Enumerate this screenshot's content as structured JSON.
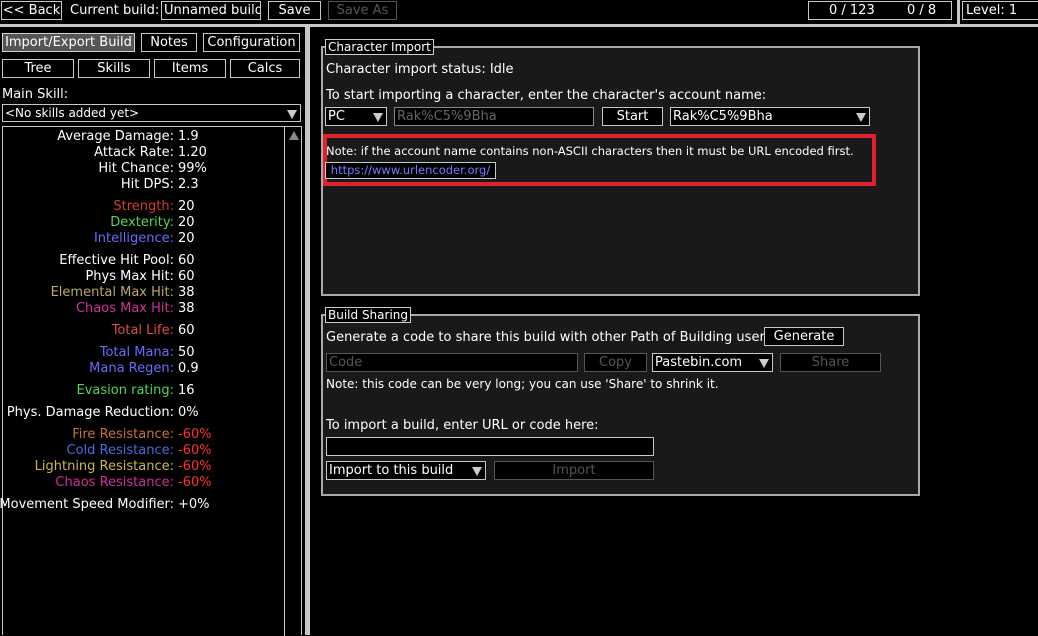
{
  "topbar": {
    "back_label": "<< Back",
    "current_build_label": "Current build:",
    "build_name": "Unnamed build",
    "save_label": "Save",
    "save_as_label": "Save As",
    "points": "0 / 123",
    "ascend": "0 / 8",
    "level_label": "Level: 1"
  },
  "tabs": {
    "import_export": "Import/Export Build",
    "notes": "Notes",
    "configuration": "Configuration",
    "tree": "Tree",
    "skills": "Skills",
    "items": "Items",
    "calcs": "Calcs"
  },
  "main_skill": {
    "label": "Main Skill:",
    "value": "<No skills added yet>"
  },
  "stats": [
    {
      "label": "Average Damage:",
      "value": "1.9",
      "color": "#ffffff"
    },
    {
      "label": "Attack Rate:",
      "value": "1.20",
      "color": "#ffffff"
    },
    {
      "label": "Hit Chance:",
      "value": "99%",
      "color": "#ffffff"
    },
    {
      "label": "Hit DPS:",
      "value": "2.3",
      "color": "#ffffff"
    },
    {
      "label": "Strength:",
      "value": "20",
      "color": "#d43a3a"
    },
    {
      "label": "Dexterity:",
      "value": "20",
      "color": "#55d455"
    },
    {
      "label": "Intelligence:",
      "value": "20",
      "color": "#6a6aff"
    },
    {
      "label": "Effective Hit Pool:",
      "value": "60",
      "color": "#ffffff"
    },
    {
      "label": "Phys Max Hit:",
      "value": "60",
      "color": "#ffffff"
    },
    {
      "label": "Elemental Max Hit:",
      "value": "38",
      "color": "#b8a86a"
    },
    {
      "label": "Chaos Max Hit:",
      "value": "38",
      "color": "#d0309a"
    },
    {
      "label": "Total Life:",
      "value": "60",
      "color": "#e04a4a"
    },
    {
      "label": "Total Mana:",
      "value": "50",
      "color": "#6a6aff"
    },
    {
      "label": "Mana Regen:",
      "value": "0.9",
      "color": "#6a6aff"
    },
    {
      "label": "Evasion rating:",
      "value": "16",
      "color": "#55d455"
    },
    {
      "label": "Phys. Damage Reduction:",
      "value": "0%",
      "color": "#ffffff"
    },
    {
      "label": "Fire Resistance:",
      "value": "-60%",
      "color": "#c8703a",
      "value_color": "#ff3030"
    },
    {
      "label": "Cold Resistance:",
      "value": "-60%",
      "color": "#4a6adf",
      "value_color": "#ff3030"
    },
    {
      "label": "Lightning Resistance:",
      "value": "-60%",
      "color": "#c8b84a",
      "value_color": "#ff3030"
    },
    {
      "label": "Chaos Resistance:",
      "value": "-60%",
      "color": "#d0309a",
      "value_color": "#ff3030"
    },
    {
      "label": "Movement Speed Modifier:",
      "value": "+0%",
      "color": "#ffffff"
    }
  ],
  "char_import": {
    "title": "Character Import",
    "status": "Character import status: Idle",
    "instruction": "To start importing a character, enter the character's account name:",
    "realm": "PC",
    "account_placeholder": "Rak%C5%9Bha",
    "start_label": "Start",
    "account_dropdown": "Rak%C5%9Bha",
    "note": "Note: if the account name contains non-ASCII characters then it must be URL encoded first.",
    "link": "https://www.urlencoder.org/"
  },
  "build_sharing": {
    "title": "Build Sharing",
    "generate_text": "Generate a code to share this build with other Path of Building users:",
    "generate_label": "Generate",
    "code_placeholder": "Code",
    "copy_label": "Copy",
    "site": "Pastebin.com",
    "share_label": "Share",
    "note": "Note: this code can be very long; you can use 'Share' to shrink it.",
    "import_text": "To import a build, enter URL or code here:",
    "import_mode": "Import to this build",
    "import_label": "Import"
  },
  "colors": {
    "highlight": "#e0202c",
    "link": "#7878ff",
    "panel": "#191919"
  }
}
